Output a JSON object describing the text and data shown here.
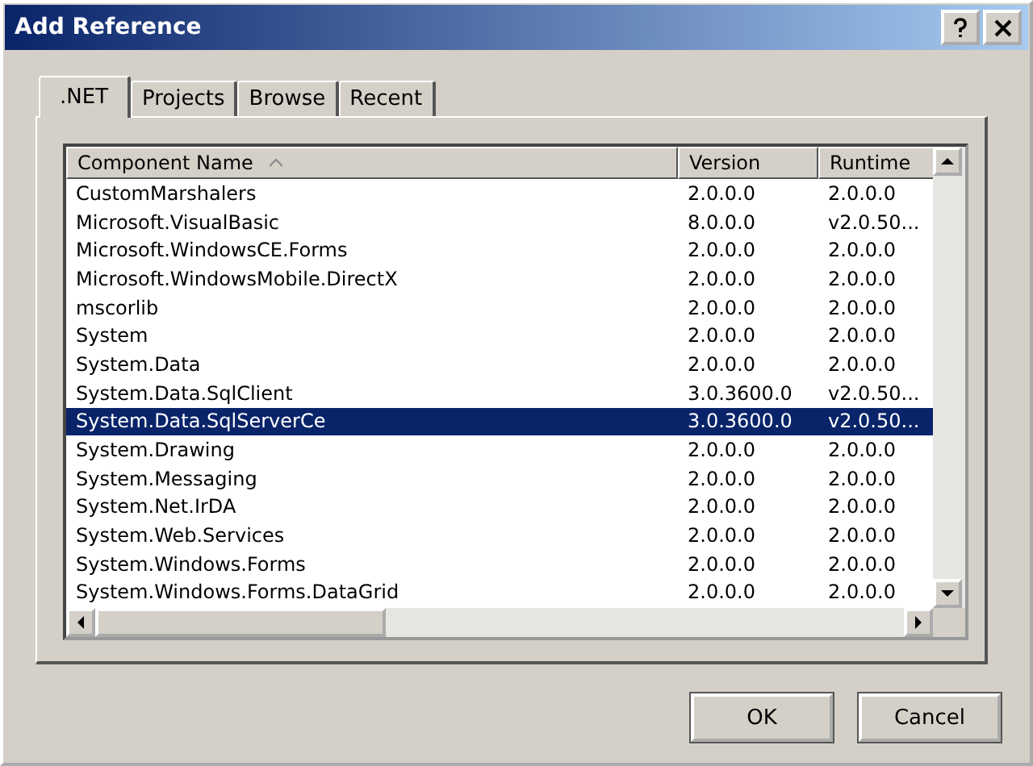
{
  "window": {
    "title": "Add Reference"
  },
  "tabs": [
    {
      "label": ".NET",
      "selected": true
    },
    {
      "label": "Projects",
      "selected": false
    },
    {
      "label": "Browse",
      "selected": false
    },
    {
      "label": "Recent",
      "selected": false
    }
  ],
  "table": {
    "columns": [
      "Component Name",
      "Version",
      "Runtime"
    ],
    "rows": [
      {
        "name": "CustomMarshalers",
        "version": "2.0.0.0",
        "runtime": "2.0.0.0",
        "selected": false
      },
      {
        "name": "Microsoft.VisualBasic",
        "version": "8.0.0.0",
        "runtime": "v2.0.50...",
        "selected": false
      },
      {
        "name": "Microsoft.WindowsCE.Forms",
        "version": "2.0.0.0",
        "runtime": "2.0.0.0",
        "selected": false
      },
      {
        "name": "Microsoft.WindowsMobile.DirectX",
        "version": "2.0.0.0",
        "runtime": "2.0.0.0",
        "selected": false
      },
      {
        "name": "mscorlib",
        "version": "2.0.0.0",
        "runtime": "2.0.0.0",
        "selected": false
      },
      {
        "name": "System",
        "version": "2.0.0.0",
        "runtime": "2.0.0.0",
        "selected": false
      },
      {
        "name": "System.Data",
        "version": "2.0.0.0",
        "runtime": "2.0.0.0",
        "selected": false
      },
      {
        "name": "System.Data.SqlClient",
        "version": "3.0.3600.0",
        "runtime": "v2.0.50...",
        "selected": false
      },
      {
        "name": "System.Data.SqlServerCe",
        "version": "3.0.3600.0",
        "runtime": "v2.0.50...",
        "selected": true
      },
      {
        "name": "System.Drawing",
        "version": "2.0.0.0",
        "runtime": "2.0.0.0",
        "selected": false
      },
      {
        "name": "System.Messaging",
        "version": "2.0.0.0",
        "runtime": "2.0.0.0",
        "selected": false
      },
      {
        "name": "System.Net.IrDA",
        "version": "2.0.0.0",
        "runtime": "2.0.0.0",
        "selected": false
      },
      {
        "name": "System.Web.Services",
        "version": "2.0.0.0",
        "runtime": "2.0.0.0",
        "selected": false
      },
      {
        "name": "System.Windows.Forms",
        "version": "2.0.0.0",
        "runtime": "2.0.0.0",
        "selected": false
      },
      {
        "name": "System.Windows.Forms.DataGrid",
        "version": "2.0.0.0",
        "runtime": "2.0.0.0",
        "selected": false
      }
    ]
  },
  "buttons": [
    "OK",
    "Cancel"
  ]
}
